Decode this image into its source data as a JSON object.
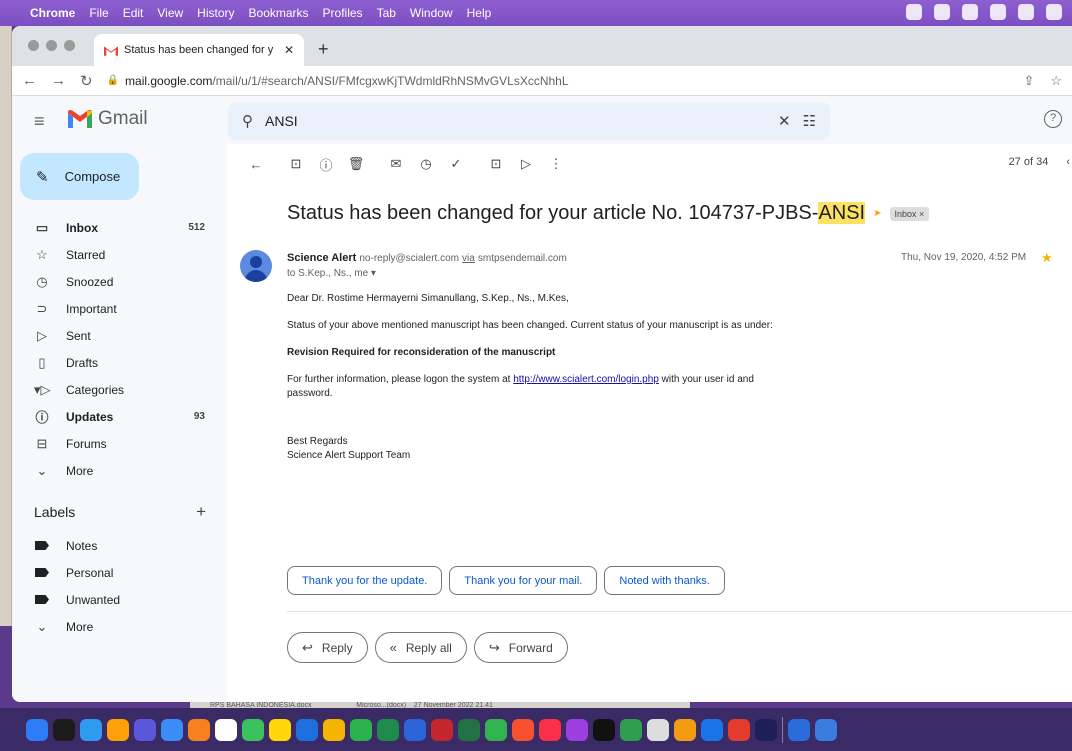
{
  "menubar": {
    "app": "Chrome",
    "items": [
      "File",
      "Edit",
      "View",
      "History",
      "Bookmarks",
      "Profiles",
      "Tab",
      "Window",
      "Help"
    ]
  },
  "browser": {
    "tab_title": "Status has been changed for y",
    "url_host": "mail.google.com",
    "url_path": "/mail/u/1/#search/ANSI/FMfcgxwKjTWdmldRhNSMvGVLsXccNhhL"
  },
  "gmail": {
    "logo_text": "Gmail",
    "search_query": "ANSI",
    "help_icon_text": "?",
    "compose_label": "Compose",
    "nav": [
      {
        "icon": "inbox-icon",
        "glyph": "▭",
        "label": "Inbox",
        "count": "512",
        "bold": true
      },
      {
        "icon": "star-icon",
        "glyph": "☆",
        "label": "Starred",
        "count": ""
      },
      {
        "icon": "clock-icon",
        "glyph": "◷",
        "label": "Snoozed",
        "count": ""
      },
      {
        "icon": "important-icon",
        "glyph": "⊃",
        "label": "Important",
        "count": ""
      },
      {
        "icon": "send-icon",
        "glyph": "▷",
        "label": "Sent",
        "count": ""
      },
      {
        "icon": "draft-icon",
        "glyph": "▯",
        "label": "Drafts",
        "count": ""
      },
      {
        "icon": "label-icon",
        "glyph": "▾▷",
        "label": "Categories",
        "count": ""
      },
      {
        "icon": "info-icon",
        "glyph": "ⓘ",
        "label": "Updates",
        "count": "93",
        "bold": true,
        "sub": true
      },
      {
        "icon": "forum-icon",
        "glyph": "⊟",
        "label": "Forums",
        "count": "",
        "sub": true
      },
      {
        "icon": "expand-icon",
        "glyph": "⌄",
        "label": "More",
        "count": ""
      }
    ],
    "labels_heading": "Labels",
    "labels": [
      "Notes",
      "Personal",
      "Unwanted"
    ],
    "labels_more": "More"
  },
  "message": {
    "pager": "27 of 34",
    "subject_prefix": "Status has been changed for your article No. 104737-PJBS-",
    "subject_highlight": "ANSI",
    "inbox_badge": "Inbox ×",
    "sender_name": "Science Alert",
    "sender_email": "no-reply@scialert.com",
    "via": "via",
    "relay": "smtpsendemail.com",
    "recipients": "to S.Kep., Ns., me ▾",
    "date": "Thu, Nov 19, 2020, 4:52 PM",
    "greeting": "Dear Dr. Rostime Hermayerni Simanullang, S.Kep., Ns., M.Kes,",
    "para1": "Status of your above mentioned manuscript has been changed. Current status of your manuscript is as under:",
    "status_line": "Revision Required for reconsideration of the manuscript",
    "para2_before": "For further information, please logon the system at ",
    "link": "http://www.scialert.com/login.php",
    "para2_after": " with your user id and password.",
    "sign1": "Best Regards",
    "sign2": "Science Alert Support Team",
    "smart_replies": [
      "Thank you for the update.",
      "Thank you for your mail.",
      "Noted with thanks."
    ],
    "reply": "Reply",
    "reply_all": "Reply all",
    "forward": "Forward"
  },
  "taskbar_doc": {
    "name": "RPS BAHASA INDONESIA.docx",
    "type": "Microso...(docx)",
    "date": "27 November 2022 21.41"
  }
}
